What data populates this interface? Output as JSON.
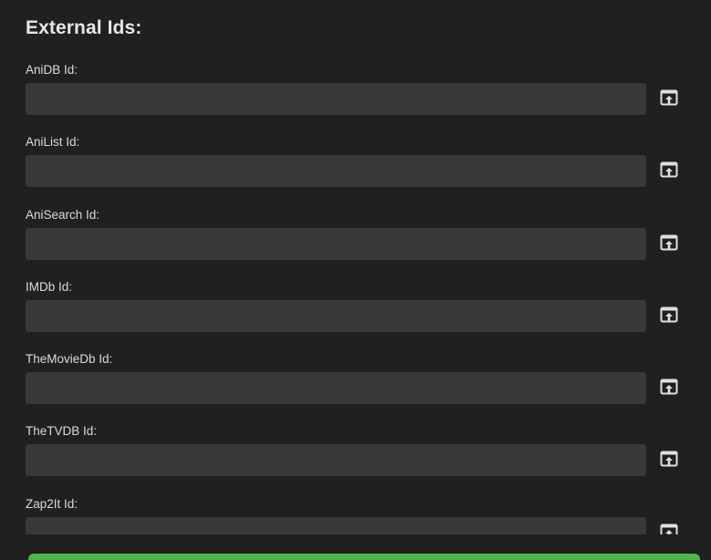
{
  "section": {
    "title": "External Ids:"
  },
  "fields": [
    {
      "label": "AniDB Id:",
      "value": "",
      "icon": "open-in-browser-icon"
    },
    {
      "label": "AniList Id:",
      "value": "",
      "icon": "open-in-browser-icon"
    },
    {
      "label": "AniSearch Id:",
      "value": "",
      "icon": "open-in-browser-icon"
    },
    {
      "label": "IMDb Id:",
      "value": "",
      "icon": "open-in-browser-icon"
    },
    {
      "label": "TheMovieDb Id:",
      "value": "",
      "icon": "open-in-browser-icon"
    },
    {
      "label": "TheTVDB Id:",
      "value": "",
      "icon": "open-in-browser-icon"
    },
    {
      "label": "Zap2It Id:",
      "value": "",
      "icon": "open-in-browser-icon"
    }
  ],
  "colors": {
    "background": "#202020",
    "input_background": "#38383b",
    "label_text": "#dadada",
    "title_text": "#e6e6e6",
    "icon": "#e0e0e0",
    "save_button": "#52b54b"
  }
}
